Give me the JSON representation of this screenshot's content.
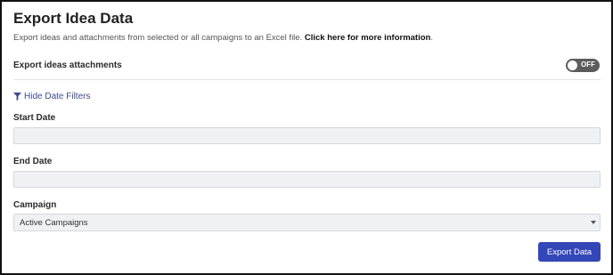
{
  "header": {
    "title": "Export Idea Data",
    "description": "Export ideas and attachments from selected or all campaigns to an Excel file.",
    "info_link": "Click here for more information",
    "description_end": "."
  },
  "attachments_toggle": {
    "label": "Export ideas attachments",
    "state": "OFF"
  },
  "filters": {
    "toggle_link": "Hide Date Filters",
    "icon": "funnel-icon",
    "start_date": {
      "label": "Start Date",
      "value": ""
    },
    "end_date": {
      "label": "End Date",
      "value": ""
    }
  },
  "campaign": {
    "label": "Campaign",
    "selected": "Active Campaigns"
  },
  "actions": {
    "export_label": "Export Data"
  },
  "colors": {
    "accent": "#3347b8",
    "link": "#3d4a8c",
    "toggle_off": "#5c5c5c"
  }
}
